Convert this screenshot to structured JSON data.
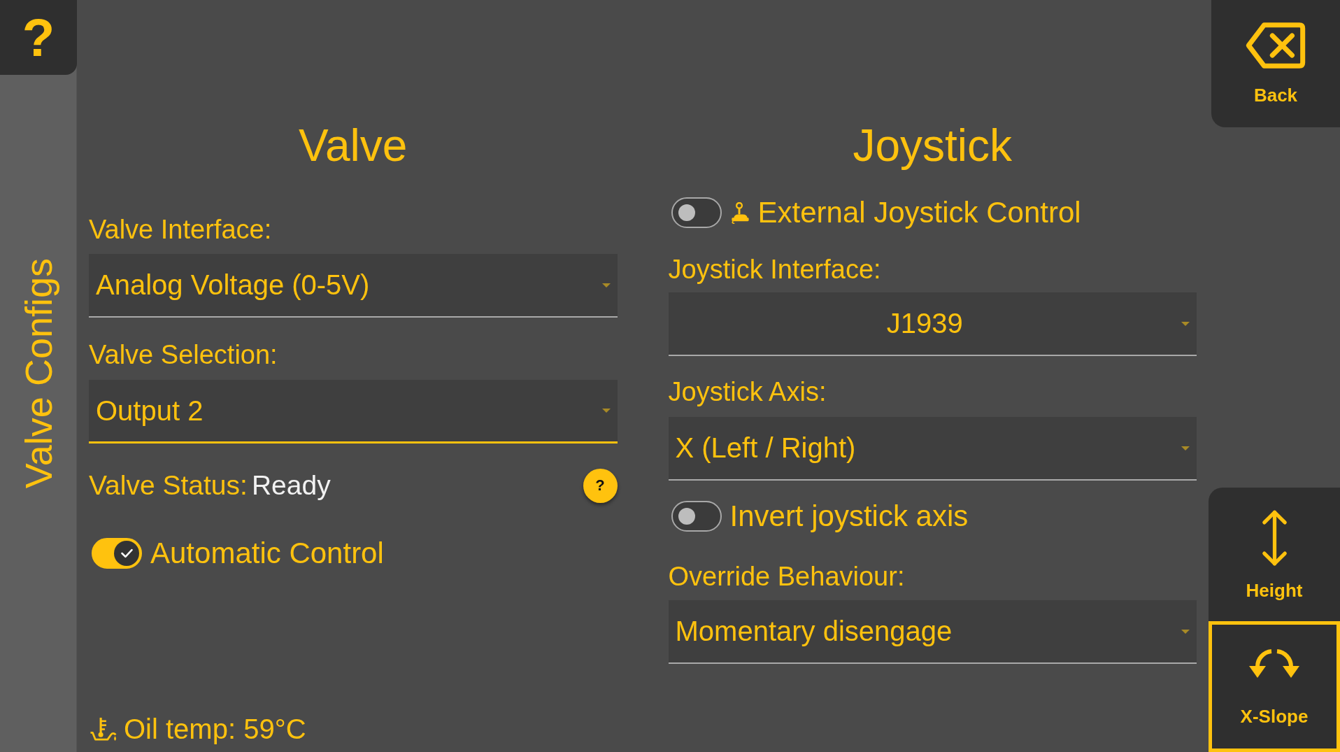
{
  "help_button": "?",
  "sidebar": {
    "title": "Valve Configs"
  },
  "valve": {
    "title": "Valve",
    "interface": {
      "label": "Valve Interface:",
      "value": "Analog Voltage (0-5V)",
      "focused": false
    },
    "selection": {
      "label": "Valve Selection:",
      "value": "Output 2",
      "focused": true
    },
    "status": {
      "label": "Valve Status:",
      "value": "Ready",
      "help": "?"
    },
    "automatic_control": {
      "label": "Automatic Control",
      "on": true
    }
  },
  "oil_temp": "Oil temp: 59°C",
  "joystick": {
    "title": "Joystick",
    "external_control": {
      "label": "External Joystick Control",
      "on": false
    },
    "interface": {
      "label": "Joystick Interface:",
      "value": "J1939",
      "focused": false
    },
    "axis": {
      "label": "Joystick Axis:",
      "value": "X (Left / Right)",
      "focused": false
    },
    "invert_axis": {
      "label": "Invert joystick axis",
      "on": false
    },
    "override_behaviour": {
      "label": "Override Behaviour:",
      "value": "Momentary disengage",
      "focused": false
    }
  },
  "nav": {
    "back": "Back",
    "tabs": [
      {
        "label": "Height",
        "selected": false
      },
      {
        "label": "X-Slope",
        "selected": true
      }
    ]
  }
}
